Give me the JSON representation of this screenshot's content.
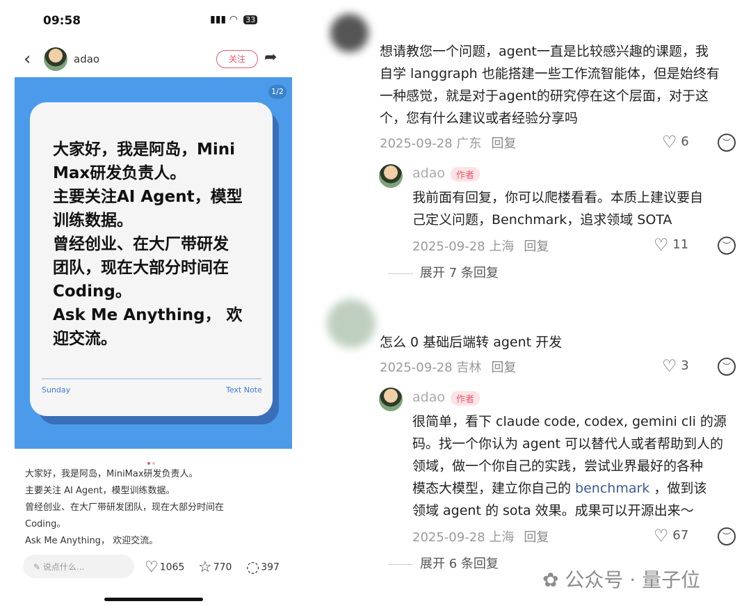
{
  "status": {
    "time": "09:58",
    "battery": "33"
  },
  "post": {
    "author": "adao",
    "follow_label": "关注",
    "page_indicator": "1/2",
    "card_text": "大家好，我是阿岛，Mini\nMax研发负责人。\n主要关注AI Agent，模型\n训练数据。\n曾经创业、在大厂带研发\n团队，现在大部分时间在\nCoding。\nAsk Me Anything， 欢\n迎交流。",
    "card_footer_left": "Sunday",
    "card_footer_right": "Text Note",
    "description": "大家好，我是阿岛，MiniMax研发负责人。\n主要关注 AI Agent，模型训练数据。\n曾经创业、在大厂带研发团队，现在大部分时间在\nCoding。\nAsk Me Anything， 欢迎交流。",
    "comment_placeholder": "说点什么...",
    "likes": "1065",
    "stars": "770",
    "comments": "397"
  },
  "comments": [
    {
      "text": "想请教您一个问题，agent一直是比较感兴趣的课题，我\n自学 langgraph 也能搭建一些工作流智能体，但是始终有\n一种感觉，就是对于agent的研究停在这个层面，对于这\n个，您有什么建议或者经验分享吗",
      "meta": "2025-09-28 广东",
      "reply": "回复",
      "likes": "6",
      "author_reply": {
        "name": "adao",
        "badge": "作者",
        "text": "我前面有回复，你可以爬楼看看。本质上建议要自\n己定义问题，Benchmark，追求领域 SOTA",
        "meta": "2025-09-28 上海",
        "reply": "回复",
        "likes": "11"
      },
      "expand": "展开 7 条回复"
    },
    {
      "text": "怎么 0 基础后端转 agent 开发",
      "meta": "2025-09-28 吉林",
      "reply": "回复",
      "likes": "3",
      "author_reply": {
        "name": "adao",
        "badge": "作者",
        "text_a": "很简单，看下 claude code, codex, gemini  cli 的源\n码。找一个你认为 agent 可以替代人或者帮助到人的\n领域，做一个你自己的实践，尝试业界最好的各种\n模态大模型，建立你自己的 ",
        "link": "benchmark",
        "text_b": " ，做到该\n领域 agent 的 sota 效果。成果可以开源出来～",
        "meta": "2025-09-28 上海",
        "reply": "回复",
        "likes": "67"
      },
      "expand": "展开 6 条回复"
    }
  ],
  "watermark": "公众号 · 量子位"
}
